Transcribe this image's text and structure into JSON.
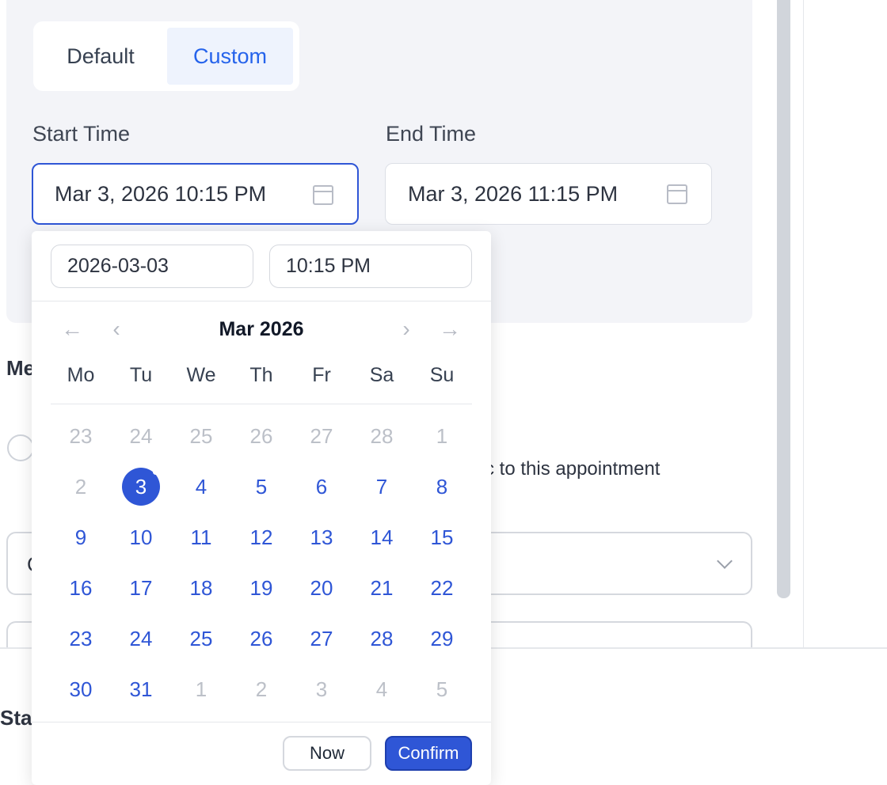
{
  "mode_toggle": {
    "default_label": "Default",
    "custom_label": "Custom",
    "selected": "Custom"
  },
  "start_time": {
    "label": "Start Time",
    "value": "Mar 3, 2026 10:15 PM",
    "icon": "calendar-icon"
  },
  "end_time": {
    "label": "End Time",
    "value": "Mar 3, 2026 11:15 PM",
    "icon": "calendar-icon"
  },
  "background": {
    "section_title_partial": "Me",
    "radio_text_partial": "c to this appointment",
    "select_text_partial": "C",
    "footer_text_partial": "Sta"
  },
  "picker": {
    "date_input": "2026-03-03",
    "time_input": "10:15 PM",
    "month_title": "Mar 2026",
    "nav": {
      "prev_year": "←",
      "prev_month": "‹",
      "next_month": "›",
      "next_year": "→"
    },
    "weekdays": [
      "Mo",
      "Tu",
      "We",
      "Th",
      "Fr",
      "Sa",
      "Su"
    ],
    "weeks": [
      [
        {
          "d": "23",
          "out": true
        },
        {
          "d": "24",
          "out": true
        },
        {
          "d": "25",
          "out": true
        },
        {
          "d": "26",
          "out": true
        },
        {
          "d": "27",
          "out": true
        },
        {
          "d": "28",
          "out": true
        },
        {
          "d": "1",
          "out": true
        }
      ],
      [
        {
          "d": "2",
          "out": true
        },
        {
          "d": "3",
          "selected": true
        },
        {
          "d": "4"
        },
        {
          "d": "5"
        },
        {
          "d": "6"
        },
        {
          "d": "7"
        },
        {
          "d": "8"
        }
      ],
      [
        {
          "d": "9"
        },
        {
          "d": "10"
        },
        {
          "d": "11"
        },
        {
          "d": "12"
        },
        {
          "d": "13"
        },
        {
          "d": "14"
        },
        {
          "d": "15"
        }
      ],
      [
        {
          "d": "16"
        },
        {
          "d": "17"
        },
        {
          "d": "18"
        },
        {
          "d": "19"
        },
        {
          "d": "20"
        },
        {
          "d": "21"
        },
        {
          "d": "22"
        }
      ],
      [
        {
          "d": "23"
        },
        {
          "d": "24"
        },
        {
          "d": "25"
        },
        {
          "d": "26"
        },
        {
          "d": "27"
        },
        {
          "d": "28"
        },
        {
          "d": "29"
        }
      ],
      [
        {
          "d": "30"
        },
        {
          "d": "31"
        },
        {
          "d": "1",
          "out": true
        },
        {
          "d": "2",
          "out": true
        },
        {
          "d": "3",
          "out": true
        },
        {
          "d": "4",
          "out": true
        },
        {
          "d": "5",
          "out": true
        }
      ]
    ],
    "now_label": "Now",
    "confirm_label": "Confirm"
  },
  "colors": {
    "accent": "#2f56d6",
    "panel_bg": "#f3f4f8",
    "muted": "#bcc0c8"
  }
}
